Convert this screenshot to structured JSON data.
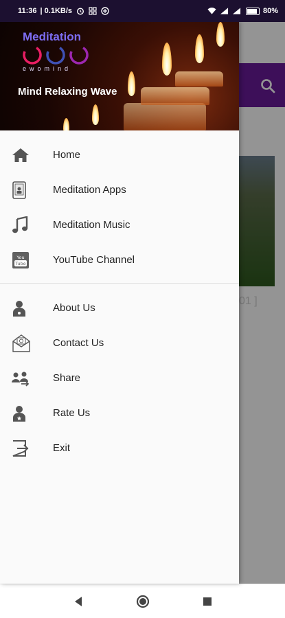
{
  "status_bar": {
    "time": "11:36",
    "speed": "| 0.1KB/s",
    "battery": "80%"
  },
  "background": {
    "partial_text": "01 ]"
  },
  "drawer": {
    "brand_title": "Meditation",
    "brand_sub": "ewomind",
    "tagline": "Mind Relaxing Wave",
    "items": [
      {
        "label": "Home",
        "icon": "home-icon"
      },
      {
        "label": "Meditation Apps",
        "icon": "tablet-icon"
      },
      {
        "label": "Meditation Music",
        "icon": "music-note-icon"
      },
      {
        "label": "YouTube Channel",
        "icon": "youtube-icon"
      },
      {
        "label": "About Us",
        "icon": "person-icon"
      },
      {
        "label": "Contact Us",
        "icon": "mail-icon"
      },
      {
        "label": "Share",
        "icon": "share-people-icon"
      },
      {
        "label": "Rate Us",
        "icon": "person-star-icon"
      },
      {
        "label": "Exit",
        "icon": "exit-icon"
      }
    ]
  },
  "colors": {
    "toolbar": "#6a1b9a",
    "status_bar": "#1c1030",
    "brand": "#7c6cf0"
  }
}
